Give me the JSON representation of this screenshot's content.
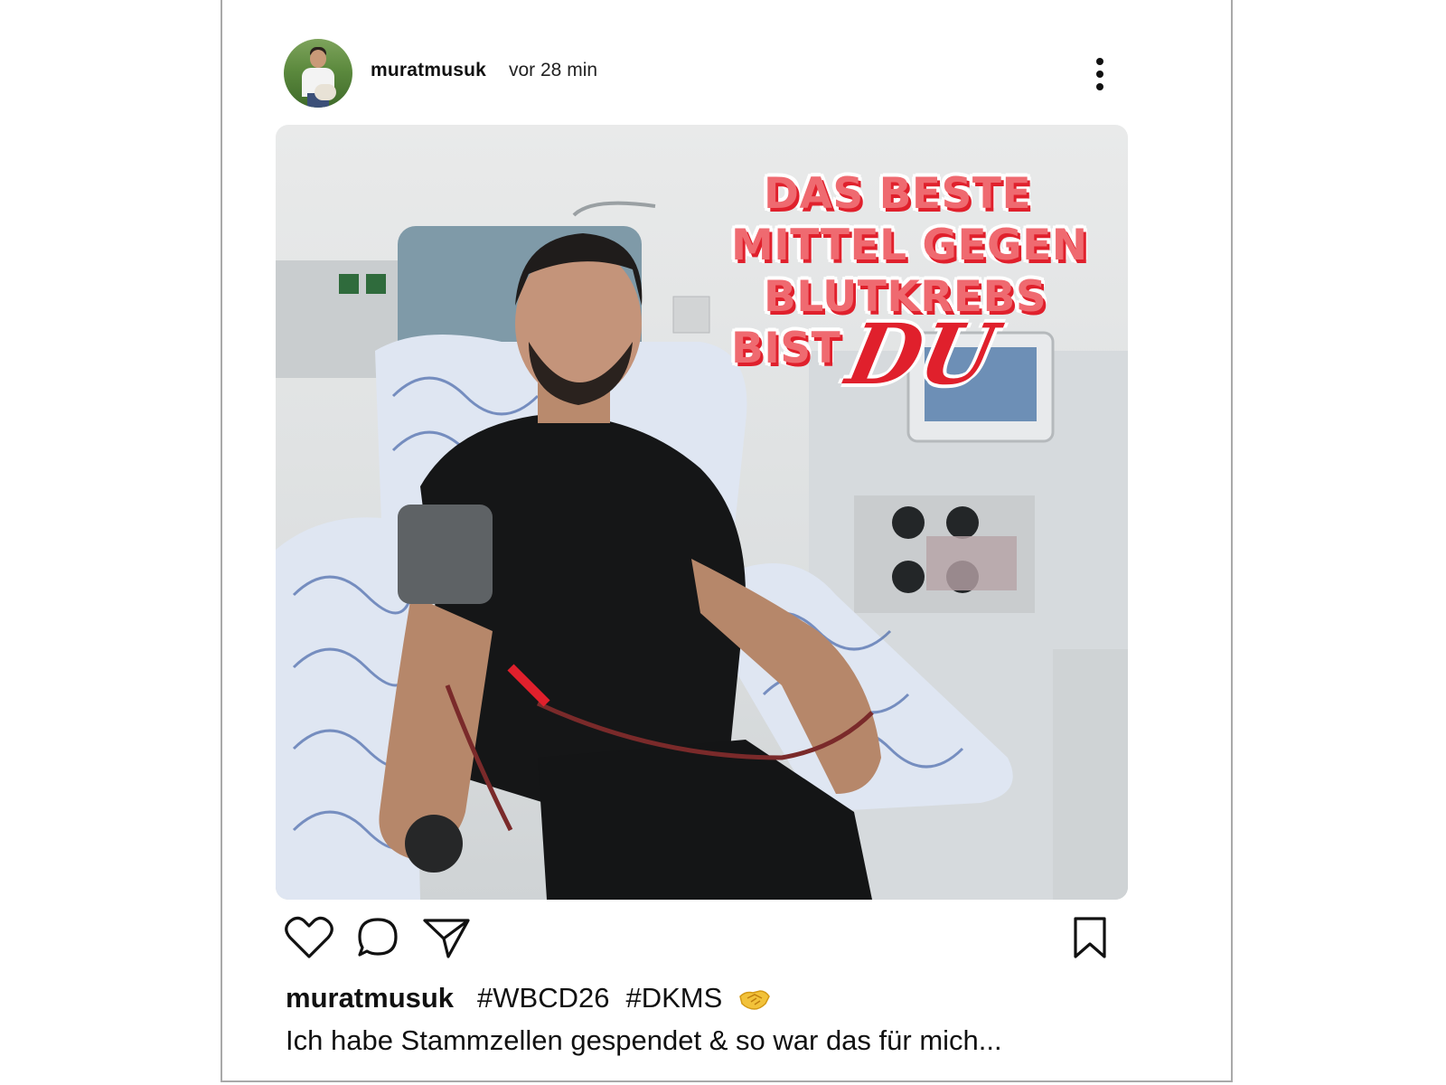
{
  "post": {
    "username": "muratmusuk",
    "time_ago": "vor 28 min",
    "overlay": {
      "line1": "DAS BESTE",
      "line2": "MITTEL GEGEN",
      "line3": "BLUTKREBS",
      "line4": "BIST",
      "accent": "DU"
    },
    "caption": {
      "username": "muratmusuk",
      "hashtags": [
        "#WBCD26",
        "#DKMS"
      ],
      "emoji": "handshake-emoji",
      "text": "Ich habe Stammzellen gespendet & so war das für mich..."
    }
  },
  "actions": {
    "like": "heart-icon",
    "comment": "comment-bubble-icon",
    "share": "paper-plane-icon",
    "save": "bookmark-icon",
    "more": "more-vertical-icon"
  },
  "colors": {
    "overlay_text": "#ef6a70",
    "overlay_shadow": "#e0202c",
    "text": "#111111",
    "border": "#a9a9a9"
  }
}
